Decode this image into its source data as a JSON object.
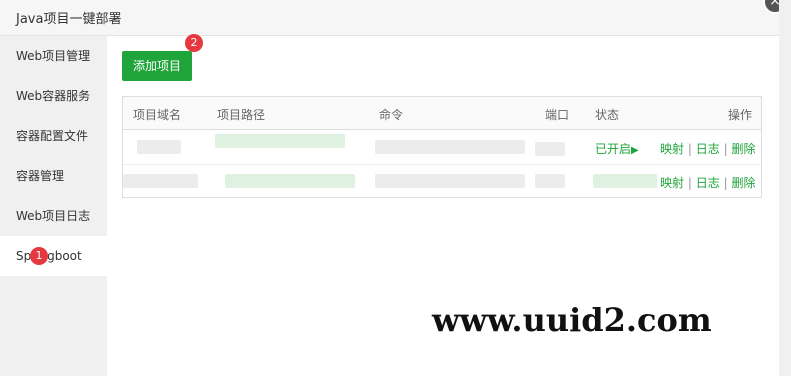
{
  "window": {
    "title": "Java项目一键部署",
    "close_glyph": "×"
  },
  "sidebar": {
    "items": [
      {
        "label": "Web项目管理"
      },
      {
        "label": "Web容器服务"
      },
      {
        "label": "容器配置文件"
      },
      {
        "label": "容器管理"
      },
      {
        "label": "Web项目日志"
      },
      {
        "label": "Springboot",
        "active": true
      }
    ]
  },
  "badges": {
    "first": "1",
    "second": "2"
  },
  "toolbar": {
    "add_label": "添加项目"
  },
  "table": {
    "headers": {
      "domain": "项目域名",
      "path": "项目路径",
      "command": "命令",
      "port": "端口",
      "status": "状态",
      "actions": "操作"
    },
    "rows": [
      {
        "status": "已开启",
        "status_icon": "▶",
        "op_map": "映射",
        "op_log": "日志",
        "op_delete": "删除",
        "sep": "|"
      },
      {
        "status": "",
        "status_icon": "",
        "op_map": "映射",
        "op_log": "日志",
        "op_delete": "删除",
        "sep": "|"
      }
    ]
  },
  "watermark": "www.uuid2.com",
  "colors": {
    "accent": "#20a53a",
    "badge": "#e6393f"
  }
}
